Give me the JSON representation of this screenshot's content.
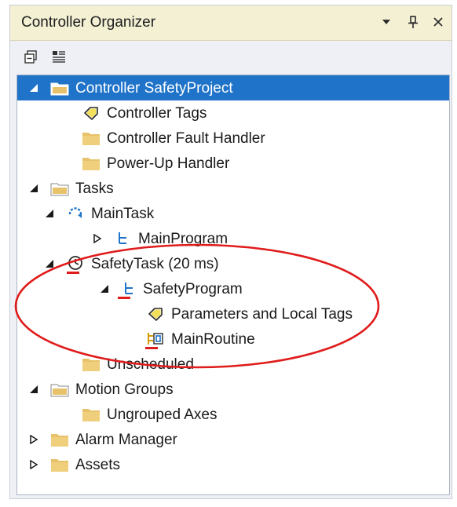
{
  "panel": {
    "title": "Controller Organizer",
    "header_icons": [
      "chevron-down-icon",
      "pin-icon",
      "close-icon"
    ]
  },
  "toolbar": {
    "icons": [
      "collapse-all-icon",
      "properties-icon"
    ]
  },
  "tree": {
    "controller": "Controller SafetyProject",
    "controller_tags": "Controller Tags",
    "fault_handler": "Controller Fault Handler",
    "powerup_handler": "Power-Up Handler",
    "tasks": "Tasks",
    "main_task": "MainTask",
    "main_program": "MainProgram",
    "safety_task": "SafetyTask (20 ms)",
    "safety_program": "SafetyProgram",
    "params_local_tags": "Parameters and Local Tags",
    "main_routine": "MainRoutine",
    "unscheduled": "Unscheduled",
    "motion_groups": "Motion Groups",
    "ungrouped_axes": "Ungrouped Axes",
    "alarm_manager": "Alarm Manager",
    "assets": "Assets"
  },
  "colors": {
    "selection": "#1f73c8",
    "titlebar": "#f3f0d4",
    "folder": "#e8c26a",
    "annotation": "#e01b1b"
  }
}
